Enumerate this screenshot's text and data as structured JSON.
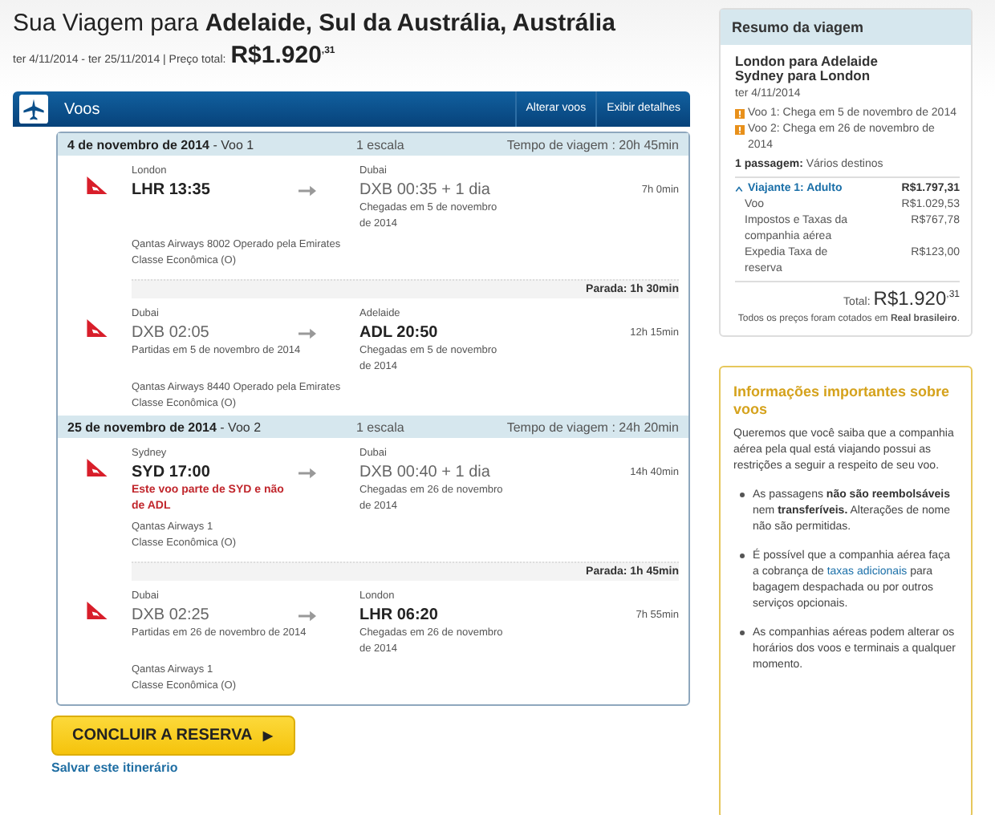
{
  "header": {
    "title": "Sua Viagem para **Adelaide, Sul da Austrália, Austrália**",
    "dates": "ter 4/11/2014 - ter 25/11/2014 | Preço total:",
    "price": "R$1.920$^{,31}$"
  },
  "flights_bar": {
    "title": "Voos",
    "actions": [
      "Alterar voos",
      "Exibir detalhes"
    ]
  },
  "legs": [
    {
      "title": "**4 de novembro de 2014** - Voo 1",
      "stops": "1 escala",
      "travel_time": "Tempo de viagem : 20h 45min",
      "segments": [
        {
          "from_city": "London",
          "from_time": "LHR 13:35",
          "from_bold": true,
          "to_city": "Dubai",
          "to_time": "DXB 00:35 + 1 dia",
          "to_bold": false,
          "to_note": "Chegadas em 5 de novembro de 2014",
          "duration": "7h 0min",
          "airline": "Qantas Airways 8002 Operado pela Emirates",
          "cabin": "Classe Econômica (O)"
        },
        {
          "layover": "Parada:  1h 30min",
          "from_city": "Dubai",
          "from_time": "DXB 02:05",
          "from_bold": false,
          "from_note": "Partidas em 5 de novembro de 2014",
          "to_city": "Adelaide",
          "to_time": "ADL 20:50",
          "to_bold": true,
          "to_note": "Chegadas em 5 de novembro de 2014",
          "duration": "12h 15min",
          "airline": "Qantas Airways 8440 Operado pela Emirates",
          "cabin": "Classe Econômica (O)"
        }
      ]
    },
    {
      "title": "**25 de novembro de 2014** - Voo 2",
      "stops": "1 escala",
      "travel_time": "Tempo de viagem : 24h 20min",
      "segments": [
        {
          "from_city": "Sydney",
          "from_time": "SYD 17:00",
          "from_bold": true,
          "warning": "Este voo parte de SYD e não de ADL",
          "to_city": "Dubai",
          "to_time": "DXB 00:40 + 1 dia",
          "to_bold": false,
          "to_note": "Chegadas em 26 de novembro de 2014",
          "duration": "14h 40min",
          "airline": "Qantas Airways 1",
          "cabin": "Classe Econômica (O)"
        },
        {
          "layover": "Parada:  1h 45min",
          "from_city": "Dubai",
          "from_time": "DXB 02:25",
          "from_bold": false,
          "from_note": "Partidas em 26 de novembro de 2014",
          "to_city": "London",
          "to_time": "LHR 06:20",
          "to_bold": true,
          "to_note": "Chegadas em 26 de novembro de 2014",
          "duration": "7h 55min",
          "airline": "Qantas Airways 1",
          "cabin": "Classe Econômica (O)"
        }
      ]
    }
  ],
  "book_button": "CONCLUIR A RESERVA",
  "save_link": "Salvar este itinerário",
  "summary": {
    "title": "Resumo da viagem",
    "routes": [
      "London para Adelaide",
      "Sydney para London"
    ],
    "date": "ter 4/11/2014",
    "notes": [
      "Voo 1: Chega em 5 de novembro de 2014",
      "Voo 2: Chega em 26 de novembro de 2014"
    ],
    "tickets": "**1 passagem:** Vários destinos",
    "traveler": {
      "label": "Viajante 1: Adulto",
      "amount": "R$1.797,31",
      "expanded": true
    },
    "items": [
      {
        "label": "Voo",
        "amount": "R$1.029,53"
      },
      {
        "label": "Impostos e Taxas da companhia aérea",
        "amount": "R$767,78"
      },
      {
        "label": "Expedia Taxa de reserva",
        "amount": "R$123,00"
      }
    ],
    "total_label": "Total:",
    "total": "R$1.920$^{,31}$",
    "footnote": "Todos os preços foram cotados em **Real brasileiro**."
  },
  "info": {
    "title": "Informações importantes sobre voos",
    "intro": "Queremos que você saiba que a companhia aérea pela qual está viajando possui as restrições a seguir a respeito de seu voo.",
    "bullets": [
      {
        "text": "As passagens **não são reembolsáveis** nem **transferíveis.** Alterações de nome não são permitidas."
      },
      {
        "text": "É possível que a companhia aérea faça a cobrança de ",
        "link": "taxas adicionais",
        "after": " para bagagem despachada ou por outros serviços opcionais."
      },
      {
        "text": "As companhias aéreas podem alterar os horários dos voos e terminais a qualquer momento."
      }
    ]
  }
}
